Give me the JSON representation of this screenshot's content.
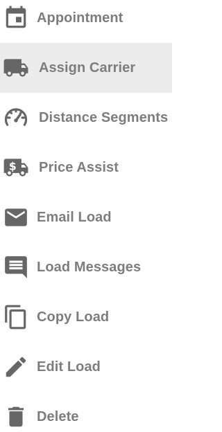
{
  "menu": {
    "items": [
      {
        "label": "Appointment",
        "icon": "calendar-icon",
        "active": false
      },
      {
        "label": "Assign Carrier",
        "icon": "truck-icon",
        "active": true
      },
      {
        "label": "Distance Segments",
        "icon": "speedometer-icon",
        "active": false
      },
      {
        "label": "Price Assist",
        "icon": "dollar-truck-icon",
        "active": false
      },
      {
        "label": "Email Load",
        "icon": "envelope-icon",
        "active": false
      },
      {
        "label": "Load Messages",
        "icon": "message-icon",
        "active": false
      },
      {
        "label": "Copy Load",
        "icon": "copy-icon",
        "active": false
      },
      {
        "label": "Edit Load",
        "icon": "pencil-icon",
        "active": false
      },
      {
        "label": "Delete",
        "icon": "trash-icon",
        "active": false
      }
    ]
  },
  "colors": {
    "text": "#7d7d7d",
    "icon": "#666666",
    "active_background": "#ececec",
    "background": "#ffffff"
  }
}
